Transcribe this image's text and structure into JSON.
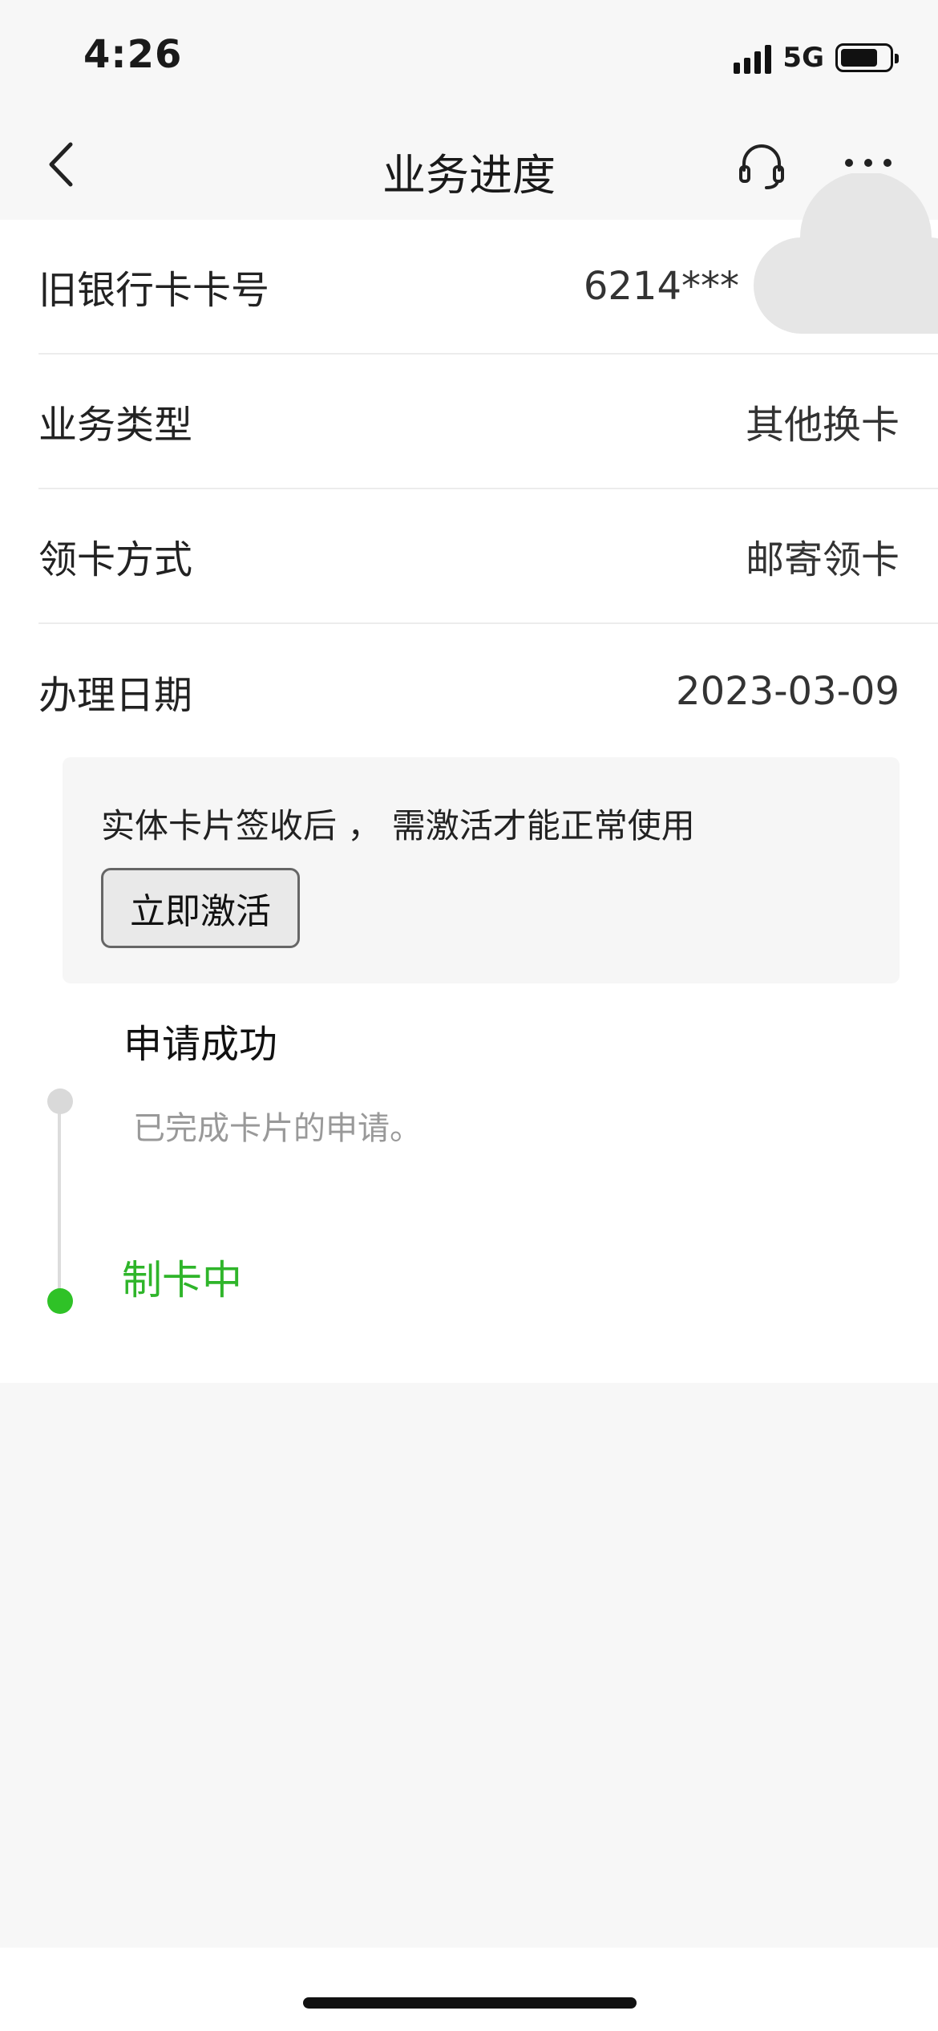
{
  "status_bar": {
    "time": "4:26",
    "network": "5G"
  },
  "nav": {
    "title": "业务进度",
    "icons": [
      "back-chevron-icon",
      "headset-icon",
      "more-icon"
    ]
  },
  "details": [
    {
      "label": "旧银行卡卡号",
      "value": "6214***"
    },
    {
      "label": "业务类型",
      "value": "其他换卡"
    },
    {
      "label": "领卡方式",
      "value": "邮寄领卡"
    },
    {
      "label": "办理日期",
      "value": "2023-03-09"
    }
  ],
  "notice": {
    "text": "实体卡片签收后 ， 需激活才能正常使用",
    "button": "立即激活"
  },
  "timeline": [
    {
      "title": "申请成功",
      "desc": "已完成卡片的申请。"
    },
    {
      "title": "制卡中"
    }
  ],
  "colors": {
    "accent_green": "#2fb52a",
    "background": "#f7f7f7",
    "card": "#ffffff"
  }
}
